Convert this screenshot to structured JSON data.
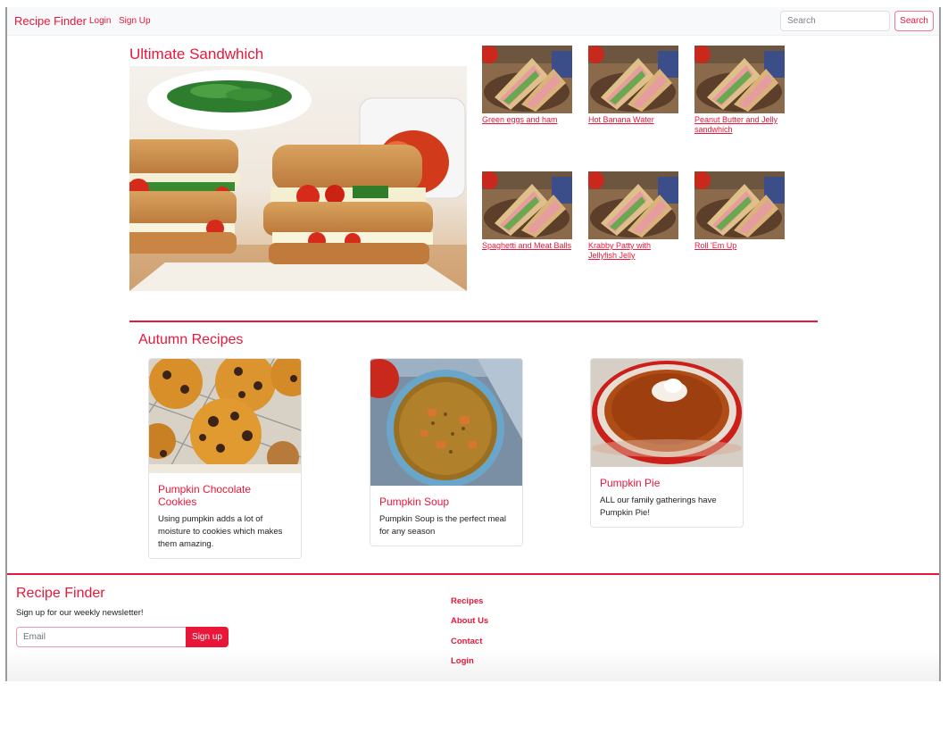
{
  "navbar": {
    "brand": "Recipe Finder",
    "links": [
      "Login",
      "Sign Up"
    ],
    "search_placeholder": "Search",
    "search_button": "Search"
  },
  "featured": {
    "title": "Ultimate Sandwhich",
    "image": "grilled-cheese-sandwich-photo"
  },
  "thumbnails": [
    {
      "label": "Green eggs and ham",
      "image": "sandwich-photo"
    },
    {
      "label": "Hot Banana Water",
      "image": "sandwich-photo"
    },
    {
      "label": "Peanut Butter and Jelly sandwhich",
      "image": "sandwich-photo"
    },
    {
      "label": "Spaghetti and Meat Balls",
      "image": "sandwich-photo"
    },
    {
      "label": "Krabby Patty with Jellyfish Jelly",
      "image": "sandwich-photo"
    },
    {
      "label": "Roll 'Em Up",
      "image": "sandwich-photo"
    }
  ],
  "autumn": {
    "title": "Autumn Recipes",
    "cards": [
      {
        "title": "Pumpkin Chocolate Cookies",
        "text": "Using pumpkin adds a lot of moisture to cookies which makes them amazing.",
        "image": "cookies-photo"
      },
      {
        "title": "Pumpkin Soup",
        "text": "Pumpkin Soup is the perfect meal for any season",
        "image": "soup-photo"
      },
      {
        "title": "Pumpkin Pie",
        "text": "ALL our family gatherings have Pumpkin Pie!",
        "image": "pie-photo"
      }
    ]
  },
  "footer": {
    "title": "Recipe Finder",
    "subtitle": "Sign up for our weekly newsletter!",
    "email_placeholder": "Email",
    "signup_button": "Sign up",
    "links": [
      "Recipes",
      "About Us",
      "Contact",
      "Login"
    ]
  },
  "colors": {
    "accent": "#e8173a",
    "navbar_bg": "#f8f9fa"
  }
}
